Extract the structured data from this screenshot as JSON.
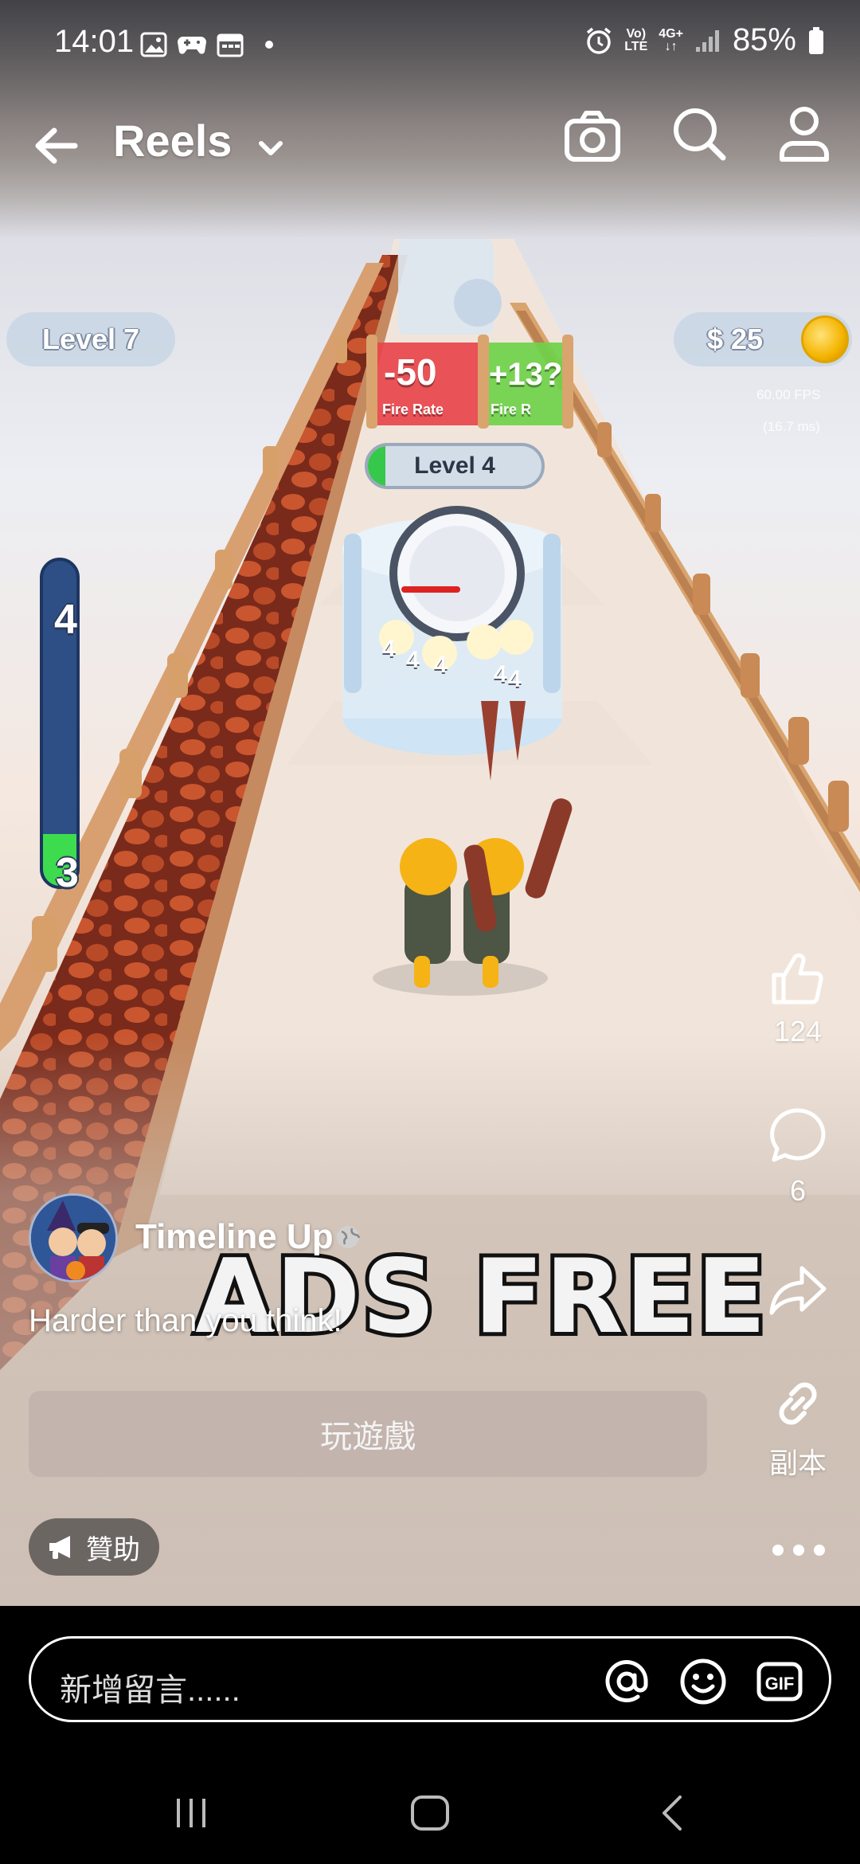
{
  "status_bar": {
    "time": "14:01",
    "network_top": "Vo)",
    "network_bottom": "LTE",
    "data_type": "4G+",
    "battery": "85%",
    "notification_icons": [
      "image-icon",
      "game-controller-icon",
      "calendar-icon",
      "dot-icon"
    ],
    "right_icons": [
      "alarm-icon",
      "volte-icon",
      "data-arrows-icon",
      "signal-icon",
      "battery-icon"
    ]
  },
  "top_bar": {
    "title": "Reels",
    "icons": [
      "back-arrow-icon",
      "chevron-down-icon",
      "camera-icon",
      "search-icon",
      "profile-icon"
    ]
  },
  "game_overlay": {
    "level_label": "Level 7",
    "money": "$ 25",
    "fps_text": "60.00 FPS",
    "fps_sub": "(16.7 ms)",
    "gate_red_value": "-50",
    "gate_red_label": "Fire Rate",
    "gate_green_value": "+13?",
    "gate_green_label": "Fire R",
    "turret_level": "Level 4",
    "progress_top": "4",
    "progress_bottom": "3",
    "progress_fraction": 0.16,
    "ammo_digits": [
      "4",
      "4",
      "4",
      "4",
      "4"
    ],
    "banner": "ADS FREE"
  },
  "actions": {
    "like_count": "124",
    "comment_count": "6",
    "copy_label": "副本",
    "icons": [
      "like-icon",
      "comment-icon",
      "share-icon",
      "link-icon",
      "more-icon"
    ]
  },
  "post": {
    "author": "Timeline Up",
    "caption": "Harder than you think!",
    "cta_label": "玩遊戲",
    "sponsored_label": "贊助"
  },
  "comment_bar": {
    "placeholder": "新增留言......",
    "icons": [
      "mention-icon",
      "emoji-icon",
      "gif-icon"
    ]
  },
  "nav_bar": {
    "icons": [
      "recent-apps-icon",
      "home-icon",
      "back-icon"
    ]
  },
  "colors": {
    "accent_green": "#3ddc4f",
    "gate_red": "#e8454b",
    "gate_green": "#6fd24a",
    "track_brown": "#7a2a1a",
    "progress_blue": "#2d4f86"
  }
}
